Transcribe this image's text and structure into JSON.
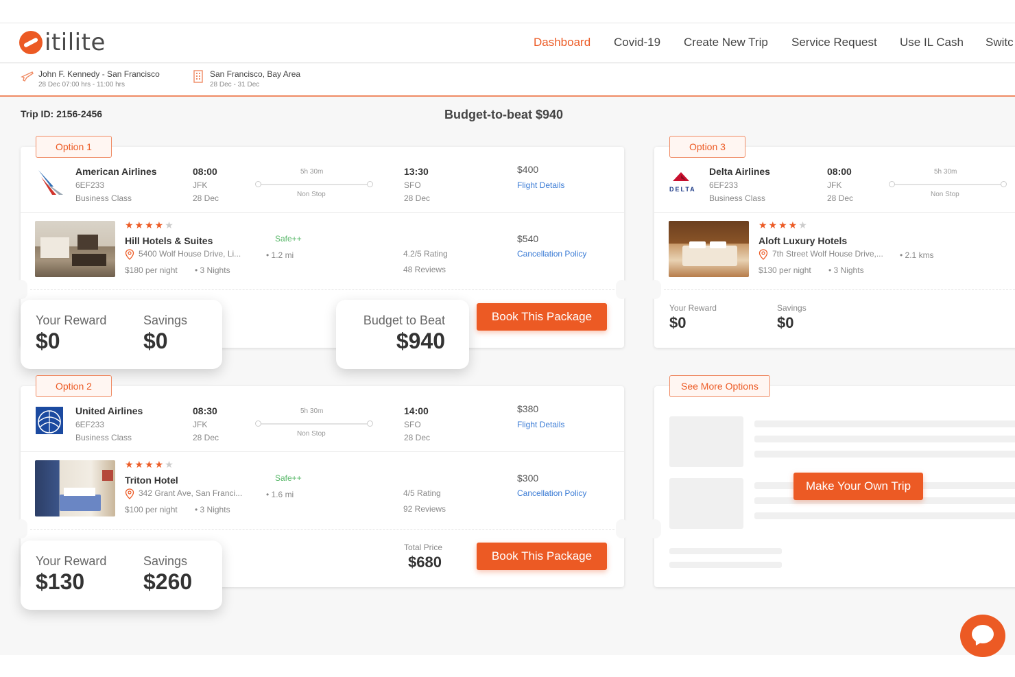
{
  "brand": {
    "logo_text": "itilite",
    "accent": "#ec5a24",
    "link_color": "#3a7bd5"
  },
  "nav": {
    "dashboard": "Dashboard",
    "covid": "Covid-19",
    "create_trip": "Create New Trip",
    "service_request": "Service Request",
    "il_cash": "Use IL Cash",
    "switch": "Switc"
  },
  "trip_strip": {
    "flight": {
      "title": "John F. Kennedy - San Francisco",
      "sub": "28 Dec 07:00 hrs - 11:00 hrs",
      "icon": "plane-icon"
    },
    "hotel": {
      "title": "San Francisco, Bay Area",
      "sub": "28 Dec - 31 Dec",
      "icon": "building-icon"
    }
  },
  "trip_id": "Trip ID: 2156-2456",
  "budget_title": "Budget-to-beat $940",
  "option1": {
    "tag": "Option 1",
    "flight": {
      "airline": "American Airlines",
      "code": "6EF233",
      "class": "Business Class",
      "dep_time": "08:00",
      "dep_airport": "JFK",
      "dep_date": "28 Dec",
      "duration": "5h 30m",
      "stops": "Non Stop",
      "arr_time": "13:30",
      "arr_airport": "SFO",
      "arr_date": "28 Dec",
      "price": "$400",
      "details": "Flight Details"
    },
    "hotel": {
      "stars": 4,
      "star_text_on": "★★★★",
      "star_text_off": "★",
      "name": "Hill Hotels & Suites",
      "safe": "Safe++",
      "address": "5400 Wolf House Drive, Li...",
      "distance": "1.2 mi",
      "per_night": "$180 per night",
      "nights": "3 Nights",
      "rating": "4.2/5 Rating",
      "reviews": "48 Reviews",
      "price": "$540",
      "policy": "Cancellation Policy"
    },
    "reward_label": "Your Reward",
    "reward_value": "$0",
    "savings_label": "Savings",
    "savings_value": "$0",
    "btb_label": "Budget to Beat",
    "btb_value": "$940",
    "book": "Book This Package"
  },
  "option2": {
    "tag": "Option 2",
    "flight": {
      "airline": "United Airlines",
      "code": "6EF233",
      "class": "Business Class",
      "dep_time": "08:30",
      "dep_airport": "JFK",
      "dep_date": "28 Dec",
      "duration": "5h 30m",
      "stops": "Non Stop",
      "arr_time": "14:00",
      "arr_airport": "SFO",
      "arr_date": "28 Dec",
      "price": "$380",
      "details": "Flight Details"
    },
    "hotel": {
      "stars": 4,
      "star_text_on": "★★★★",
      "star_text_off": "★",
      "name": "Triton Hotel",
      "safe": "Safe++",
      "address": "342 Grant Ave, San Franci...",
      "distance": "1.6 mi",
      "per_night": "$100 per night",
      "nights": "3 Nights",
      "rating": "4/5 Rating",
      "reviews": "92 Reviews",
      "price": "$300",
      "policy": "Cancellation Policy"
    },
    "reward_label": "Your Reward",
    "reward_value": "$130",
    "savings_label": "Savings",
    "savings_value": "$260",
    "total_label": "Total Price",
    "total_value": "$680",
    "book": "Book This Package"
  },
  "option3": {
    "tag": "Option 3",
    "flight": {
      "airline": "Delta Airlines",
      "logo_text": "DELTA",
      "code": "6EF233",
      "class": "Business Class",
      "dep_time": "08:00",
      "dep_airport": "JFK",
      "dep_date": "28 Dec",
      "duration": "5h 30m",
      "stops": "Non Stop"
    },
    "hotel": {
      "stars": 4,
      "star_text_on": "★★★★",
      "star_text_off": "★",
      "name": "Aloft Luxury Hotels",
      "address": "7th Street Wolf House Drive,...",
      "distance": "2.1 kms",
      "per_night": "$130 per night",
      "nights": "3 Nights"
    },
    "reward_label": "Your Reward",
    "reward_value": "$0",
    "savings_label": "Savings",
    "savings_value": "$0"
  },
  "more": {
    "tag": "See More Options",
    "make_trip": "Make Your Own Trip"
  },
  "chat": {
    "icon": "chat-icon"
  }
}
